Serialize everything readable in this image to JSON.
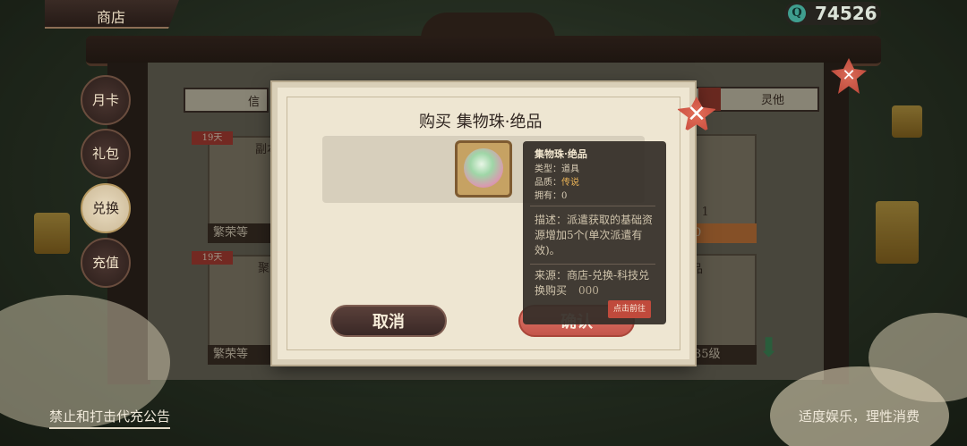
{
  "header": {
    "title": "商店",
    "currency_symbol": "Q",
    "currency_value": "74526"
  },
  "side_nav": [
    {
      "label": "月卡",
      "active": false
    },
    {
      "label": "礼包",
      "active": false
    },
    {
      "label": "兑换",
      "active": true
    },
    {
      "label": "充值",
      "active": false
    }
  ],
  "tabs": {
    "left_partial": "信",
    "right_partial": "灵他"
  },
  "cards": [
    {
      "ribbon": "19天",
      "caption": "繁荣等",
      "top": "副本"
    },
    {
      "ribbon": "19天",
      "caption": "繁荣等",
      "top": "聚"
    },
    {
      "caption": "0",
      "top": ": 1"
    },
    {
      "caption": "35级",
      "top": "品"
    }
  ],
  "modal": {
    "title": "购买 集物珠·绝品",
    "cancel_label": "取消",
    "confirm_label": "确认",
    "close_symbol": "✕"
  },
  "tooltip": {
    "name": "集物珠·绝品",
    "type_label": "类型：",
    "type_value": "道具",
    "quality_label": "品质：",
    "quality_value": "传说",
    "owned_label": "拥有：",
    "owned_value": "0",
    "description": "描述：派遣获取的基础资源增加5个(单次派遣有效)。",
    "source": "来源：商店-兑换-科技兑换购买",
    "price_partial": "000",
    "goto_label": "点击前往"
  },
  "footer": {
    "left_notice": "禁止和打击代充公告",
    "right_notice": "适度娱乐，理性消费"
  },
  "colors": {
    "accent_red": "#c4554a",
    "quality_legend": "#e9b256",
    "currency_teal": "#3f9e8f"
  }
}
